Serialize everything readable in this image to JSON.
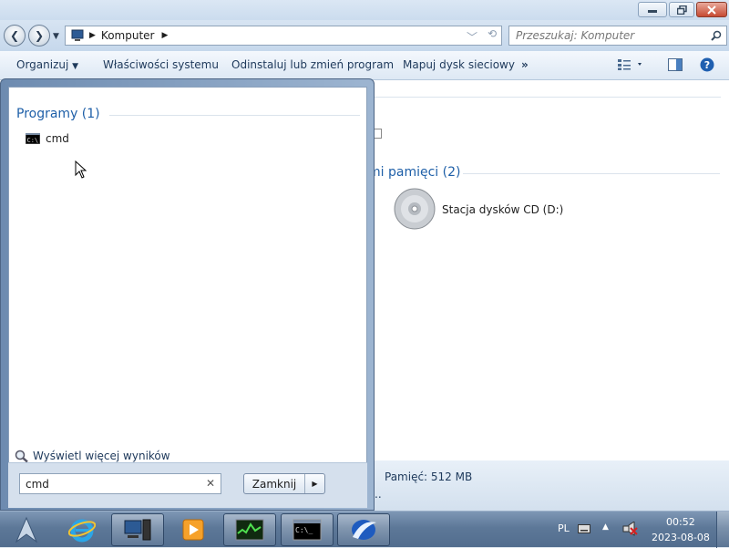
{
  "explorer": {
    "breadcrumb": "Komputer",
    "search_placeholder": "Przeszukaj: Komputer",
    "toolbar": {
      "organize": "Organizuj",
      "system_properties": "Właściwości systemu",
      "uninstall": "Odinstaluj lub zmień program",
      "map_drive": "Mapuj dysk sieciowy",
      "more": "»"
    },
    "section_partial": "mi pamięci (2)",
    "drive_label": "Stacja dysków CD (D:)",
    "status_memory": "Pamięć: 512 MB",
    "status_partial": ".."
  },
  "startmenu": {
    "group_header": "Programy (1)",
    "program_name": "cmd",
    "more_results": "Wyświetl więcej wyników",
    "search_value": "cmd",
    "shutdown_label": "Zamknij"
  },
  "taskbar": {
    "language": "PL",
    "time": "00:52",
    "date": "2023-08-08"
  },
  "colors": {
    "accent": "#1e395b",
    "header_blue": "#1e5fa8",
    "taskbar": "#5d7898"
  },
  "icons": [
    "back-icon",
    "forward-icon",
    "computer-icon",
    "search-icon",
    "view-icon",
    "pane-icon",
    "help-icon",
    "cd-drive-icon",
    "cmd-icon",
    "start-orb-icon",
    "ie-icon",
    "media-player-icon",
    "task-manager-icon",
    "console-icon",
    "app-icon",
    "keyboard-icon",
    "network-icon"
  ]
}
